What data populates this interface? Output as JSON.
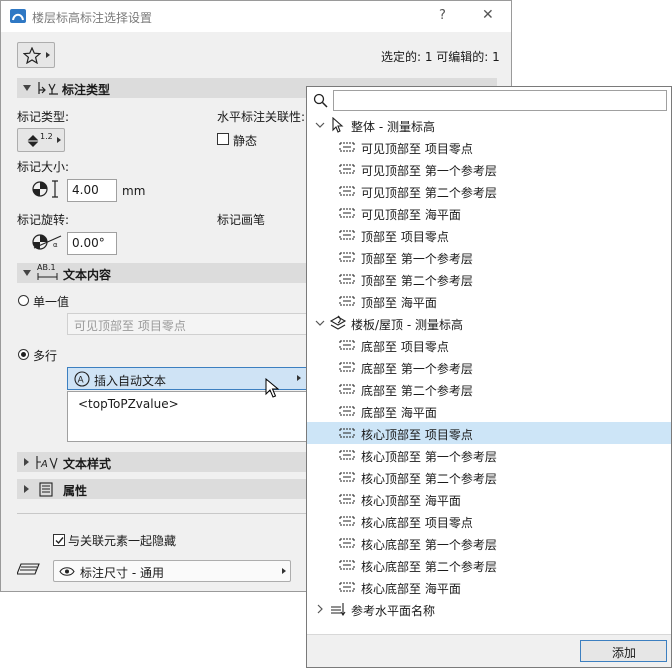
{
  "dialog": {
    "title": "楼层标高标注选择设置",
    "help_glyph": "?",
    "close_glyph": "✕",
    "selected_info": "选定的: 1 可编辑的: 1",
    "sections": {
      "marker_type": "标注类型",
      "text_content": "文本内容",
      "text_style": "文本样式",
      "properties": "属性"
    },
    "marker_type_label": "标记类型:",
    "marker_button_text": "1.2",
    "horizontal_assoc_label": "水平标注关联性:",
    "static_label": "静态",
    "marker_size_label": "标记大小:",
    "marker_size_value": "4.00",
    "marker_size_unit": "mm",
    "marker_rotation_label": "标记旋转:",
    "marker_rotation_value": "0.00°",
    "marker_pen_label": "标记画笔",
    "single_value_label": "单一值",
    "single_value_dropdown": "可见顶部至 项目零点",
    "multi_label": "多行",
    "insert_autotext_label": "插入自动文本",
    "text_area_value": "<topToPZvalue>",
    "hide_with_element_label": "与关联元素一起隐藏",
    "layer_dropdown": "标注尺寸 - 通用",
    "text_icon_label": "AB.1"
  },
  "popup": {
    "search_placeholder": "",
    "groups": [
      {
        "label": "整体 - 测量标高",
        "expanded": true,
        "items": [
          {
            "label": "可见顶部至 项目零点",
            "selected": false
          },
          {
            "label": "可见顶部至 第一个参考层",
            "selected": false
          },
          {
            "label": "可见顶部至 第二个参考层",
            "selected": false
          },
          {
            "label": "可见顶部至 海平面",
            "selected": false
          },
          {
            "label": "顶部至 项目零点",
            "selected": false
          },
          {
            "label": "顶部至 第一个参考层",
            "selected": false
          },
          {
            "label": "顶部至 第二个参考层",
            "selected": false
          },
          {
            "label": "顶部至 海平面",
            "selected": false
          }
        ]
      },
      {
        "label": "楼板/屋顶 - 测量标高",
        "expanded": true,
        "items": [
          {
            "label": "底部至 项目零点",
            "selected": false
          },
          {
            "label": "底部至 第一个参考层",
            "selected": false
          },
          {
            "label": "底部至 第二个参考层",
            "selected": false
          },
          {
            "label": "底部至 海平面",
            "selected": false
          },
          {
            "label": "核心顶部至 项目零点",
            "selected": true
          },
          {
            "label": "核心顶部至 第一个参考层",
            "selected": false
          },
          {
            "label": "核心顶部至 第二个参考层",
            "selected": false
          },
          {
            "label": "核心顶部至 海平面",
            "selected": false
          },
          {
            "label": "核心底部至 项目零点",
            "selected": false
          },
          {
            "label": "核心底部至 第一个参考层",
            "selected": false
          },
          {
            "label": "核心底部至 第二个参考层",
            "selected": false
          },
          {
            "label": "核心底部至 海平面",
            "selected": false
          }
        ]
      },
      {
        "label": "参考水平面名称",
        "expanded": false,
        "items": []
      }
    ],
    "add_button": "添加"
  },
  "colors": {
    "dialog_bg": "#f0f0f0",
    "section_bar": "#dcdcdc",
    "selection": "#cde5f7",
    "insert_button_bg": "#cfe3f5",
    "focus_border": "#3c7fc0"
  }
}
